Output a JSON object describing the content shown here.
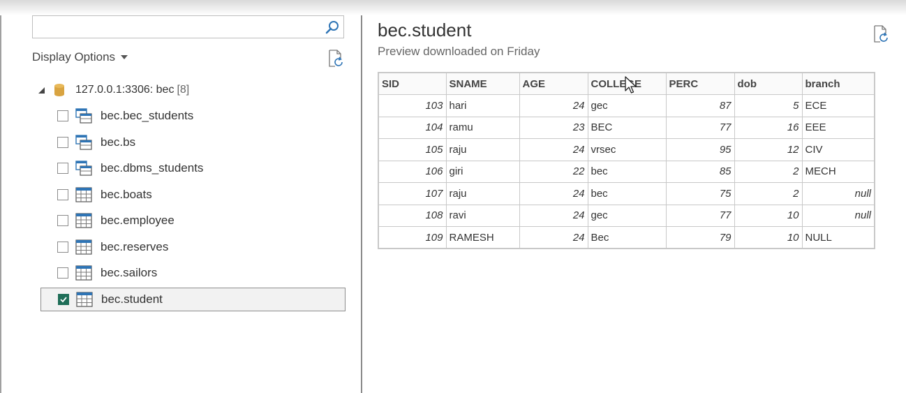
{
  "navigator": {
    "search": {
      "value": "",
      "placeholder": ""
    },
    "display_options_label": "Display Options",
    "root": {
      "label": "127.0.0.1:3306: bec",
      "count": "[8]"
    },
    "items": [
      {
        "label": "bec.bec_students",
        "icon": "view-icon",
        "checked": false
      },
      {
        "label": "bec.bs",
        "icon": "view-icon",
        "checked": false
      },
      {
        "label": "bec.dbms_students",
        "icon": "view-icon",
        "checked": false
      },
      {
        "label": "bec.boats",
        "icon": "table-icon",
        "checked": false
      },
      {
        "label": "bec.employee",
        "icon": "table-icon",
        "checked": false
      },
      {
        "label": "bec.reserves",
        "icon": "table-icon",
        "checked": false
      },
      {
        "label": "bec.sailors",
        "icon": "table-icon",
        "checked": false
      },
      {
        "label": "bec.student",
        "icon": "table-icon",
        "checked": true
      }
    ]
  },
  "preview": {
    "title": "bec.student",
    "subtitle": "Preview downloaded on Friday",
    "columns": [
      "SID",
      "SNAME",
      "AGE",
      "COLLEGE",
      "PERC",
      "dob",
      "branch"
    ],
    "rows": [
      [
        "103",
        "hari",
        "24",
        "gec",
        "87",
        "5",
        "ECE"
      ],
      [
        "104",
        "ramu",
        "23",
        "BEC",
        "77",
        "16",
        "EEE"
      ],
      [
        "105",
        "raju",
        "24",
        "vrsec",
        "95",
        "12",
        "CIV"
      ],
      [
        "106",
        "giri",
        "22",
        "bec",
        "85",
        "2",
        "MECH"
      ],
      [
        "107",
        "raju",
        "24",
        "bec",
        "75",
        "2",
        "null"
      ],
      [
        "108",
        "ravi",
        "24",
        "gec",
        "77",
        "10",
        "null"
      ],
      [
        "109",
        "RAMESH",
        "24",
        "Bec",
        "79",
        "10",
        "NULL"
      ]
    ]
  },
  "colors": {
    "checkbox_checked": "#1f6e58",
    "table_icon_blue": "#2e74b5",
    "database_icon": "#d9a441"
  }
}
